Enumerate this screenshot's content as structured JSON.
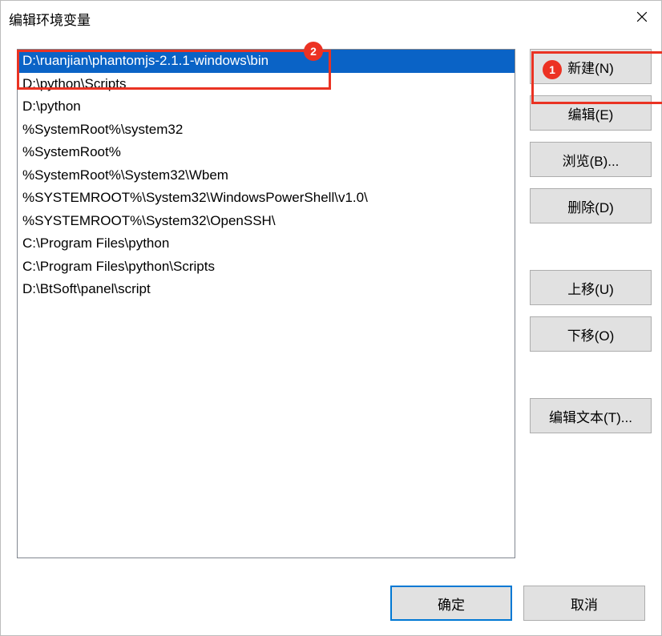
{
  "dialog": {
    "title": "编辑环境变量"
  },
  "list": {
    "items": [
      "D:\\ruanjian\\phantomjs-2.1.1-windows\\bin",
      "D:\\python\\Scripts",
      "D:\\python",
      "%SystemRoot%\\system32",
      "%SystemRoot%",
      "%SystemRoot%\\System32\\Wbem",
      "%SYSTEMROOT%\\System32\\WindowsPowerShell\\v1.0\\",
      "%SYSTEMROOT%\\System32\\OpenSSH\\",
      "C:\\Program Files\\python",
      "C:\\Program Files\\python\\Scripts",
      "D:\\BtSoft\\panel\\script"
    ],
    "selected_index": 0
  },
  "buttons": {
    "new": "新建(N)",
    "edit": "编辑(E)",
    "browse": "浏览(B)...",
    "delete": "删除(D)",
    "moveup": "上移(U)",
    "movedown": "下移(O)",
    "edittext": "编辑文本(T)...",
    "ok": "确定",
    "cancel": "取消"
  },
  "markers": {
    "m1": "1",
    "m2": "2"
  }
}
